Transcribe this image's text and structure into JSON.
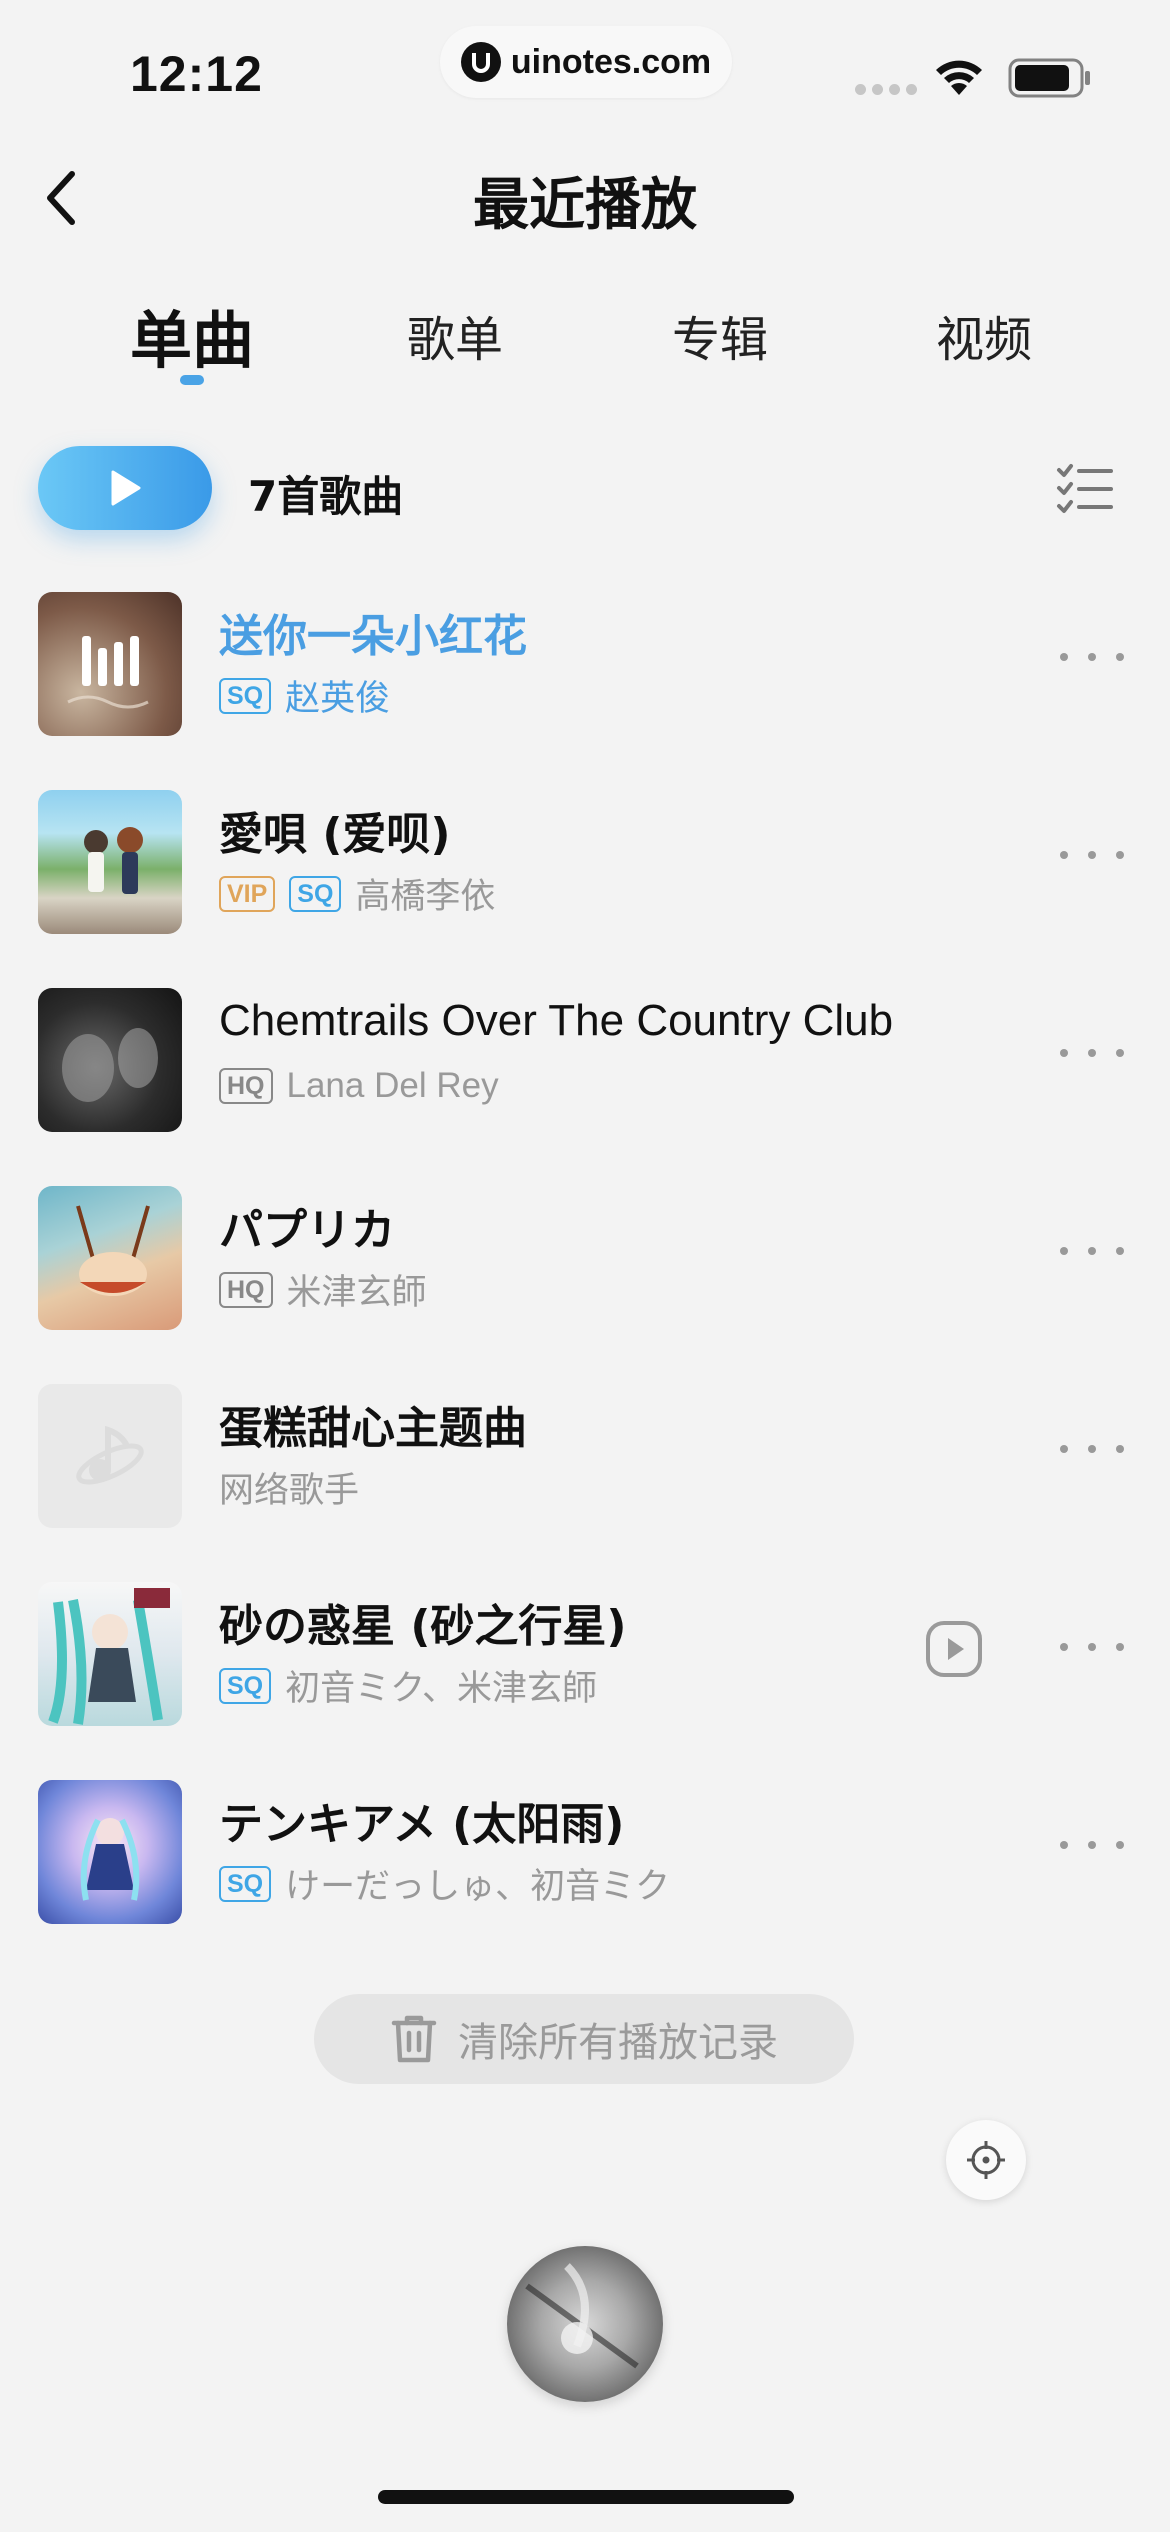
{
  "status_bar": {
    "time": "12:12",
    "url": "uinotes.com"
  },
  "header": {
    "title": "最近播放"
  },
  "tabs": [
    {
      "label": "单曲",
      "active": true
    },
    {
      "label": "歌单",
      "active": false
    },
    {
      "label": "专辑",
      "active": false
    },
    {
      "label": "视频",
      "active": false
    }
  ],
  "play_all": {
    "count_label": "7首歌曲"
  },
  "songs": [
    {
      "title": "送你一朵小红花",
      "artist": "赵英俊",
      "badges": [
        "SQ"
      ],
      "playing": true,
      "cover": "red-flower-art"
    },
    {
      "title": "愛唄 (爱呗)",
      "artist": "高橋李依",
      "badges": [
        "VIP",
        "SQ"
      ],
      "playing": false,
      "cover": "anime-seaside-art"
    },
    {
      "title": "Chemtrails Over The Country Club",
      "artist": "Lana Del Rey",
      "badges": [
        "HQ"
      ],
      "playing": false,
      "cover": "bw-photo-art"
    },
    {
      "title": "パプリカ",
      "artist": "米津玄師",
      "badges": [
        "HQ"
      ],
      "playing": false,
      "cover": "swing-painting-art"
    },
    {
      "title": "蛋糕甜心主题曲",
      "artist": "网络歌手",
      "badges": [],
      "playing": false,
      "cover": "placeholder-note-icon"
    },
    {
      "title": "砂の惑星 (砂之行星)",
      "artist": "初音ミク、米津玄師",
      "badges": [
        "SQ"
      ],
      "playing": false,
      "cover": "miku-art",
      "has_mv": true
    },
    {
      "title": "テンキアメ (太阳雨)",
      "artist": "けーだっしゅ、初音ミク",
      "badges": [
        "SQ"
      ],
      "playing": false,
      "cover": "sky-girl-art"
    }
  ],
  "clear_history": {
    "label": "清除所有播放记录"
  },
  "colors": {
    "accent": "#4a9ee2",
    "background": "#f3f3f3",
    "sq_badge": "#3fa6e6",
    "vip_badge": "#e0a55a",
    "hq_badge": "#888888"
  }
}
